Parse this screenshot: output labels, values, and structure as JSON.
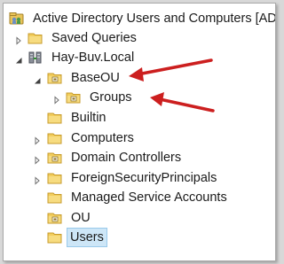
{
  "tree": {
    "root": {
      "label": "Active Directory Users and Computers [AD",
      "icon": "ad-users-computers-icon"
    },
    "items": [
      {
        "label": "Saved Queries",
        "icon": "folder-icon",
        "expander": "collapsed"
      },
      {
        "label": "Hay-Buv.Local",
        "icon": "domain-icon",
        "expander": "expanded"
      },
      {
        "label": "BaseOU",
        "icon": "ou-folder-icon",
        "expander": "expanded"
      },
      {
        "label": "Groups",
        "icon": "ou-folder-icon",
        "expander": "collapsed"
      },
      {
        "label": "Builtin",
        "icon": "folder-icon",
        "expander": "none"
      },
      {
        "label": "Computers",
        "icon": "folder-icon",
        "expander": "collapsed"
      },
      {
        "label": "Domain Controllers",
        "icon": "ou-folder-icon",
        "expander": "collapsed"
      },
      {
        "label": "ForeignSecurityPrincipals",
        "icon": "folder-icon",
        "expander": "collapsed"
      },
      {
        "label": "Managed Service Accounts",
        "icon": "folder-icon",
        "expander": "none"
      },
      {
        "label": "OU",
        "icon": "ou-folder-icon",
        "expander": "none"
      },
      {
        "label": "Users",
        "icon": "folder-icon",
        "expander": "none",
        "selected": true
      }
    ]
  },
  "annotations": {
    "arrow_color": "#cc1f1f"
  },
  "colors": {
    "selection": "#cde6f7",
    "folder": "#f2cd5c"
  }
}
